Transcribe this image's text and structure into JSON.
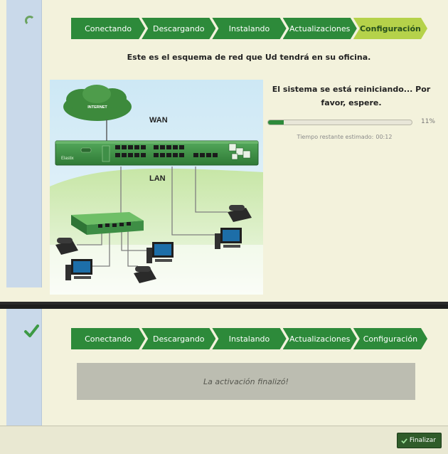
{
  "steps": [
    {
      "label": "Conectando"
    },
    {
      "label": "Descargando"
    },
    {
      "label": "Instalando"
    },
    {
      "label": "Actualizaciones"
    },
    {
      "label": "Configuración"
    }
  ],
  "top_panel": {
    "status_icon": "spinner-icon",
    "active_step_index": 4,
    "intro": "Este es el esquema de red que Ud tendrá en su oficina.",
    "diagram": {
      "cloud_label": "INTERNET",
      "wan_label": "WAN",
      "lan_label": "LAN"
    },
    "reboot_message": "El sistema se está reiniciando... Por favor, espere.",
    "progress_percent": 11,
    "progress_label": "11%",
    "eta_label": "Tiempo restante estimado:",
    "eta_value": "00:12"
  },
  "bottom_panel": {
    "status_icon": "checkmark-icon",
    "message": "La activación finalizó!",
    "finish_label": "Finalizar"
  },
  "colors": {
    "step_done": "#2d8a3a",
    "step_active": "#b5d24a",
    "finish_button": "#305c2a"
  }
}
